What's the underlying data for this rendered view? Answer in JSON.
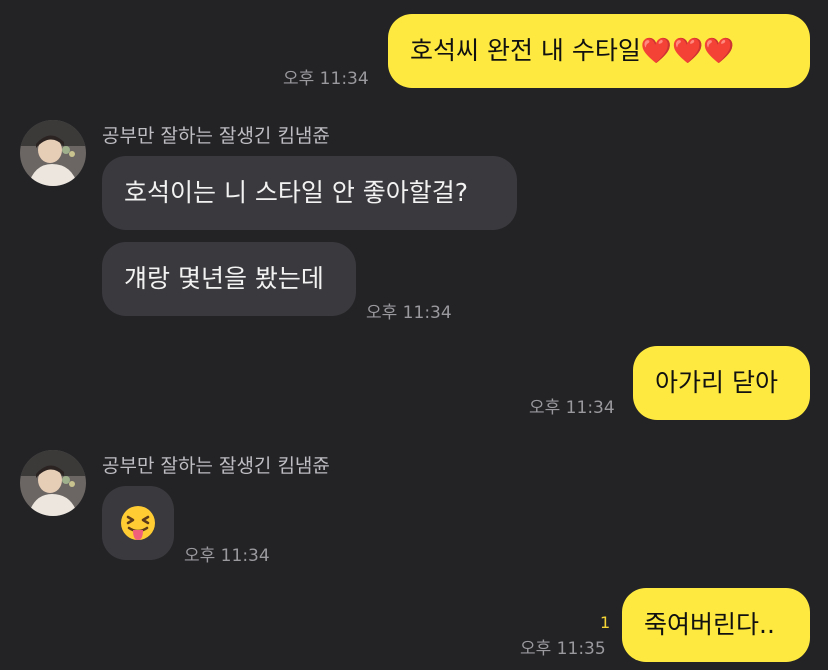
{
  "messages": {
    "m1": {
      "text": "호석씨 완전 내 수타일",
      "hearts": "❤️❤️❤️",
      "time": "오후 11:34"
    },
    "m2": {
      "sender": "공부만 잘하는 잘생긴 킴냄쥰",
      "text": "호석이는 니 스타일 안 좋아할걸?"
    },
    "m3": {
      "text": "걔랑 몇년을 봤는데",
      "time": "오후 11:34"
    },
    "m4": {
      "text": "아가리 닫아",
      "time": "오후 11:34"
    },
    "m5": {
      "sender": "공부만 잘하는 잘생긴 킴냄쥰",
      "emoji": "😝",
      "time": "오후 11:34"
    },
    "m6": {
      "text": "죽여버린다..",
      "time": "오후 11:35",
      "unread": "1"
    }
  },
  "colors": {
    "background": "#232326",
    "my_bubble": "#FDE93F",
    "their_bubble": "#3A3A3E",
    "timestamp": "#9A9A9E",
    "unread_count": "#F5D535"
  }
}
